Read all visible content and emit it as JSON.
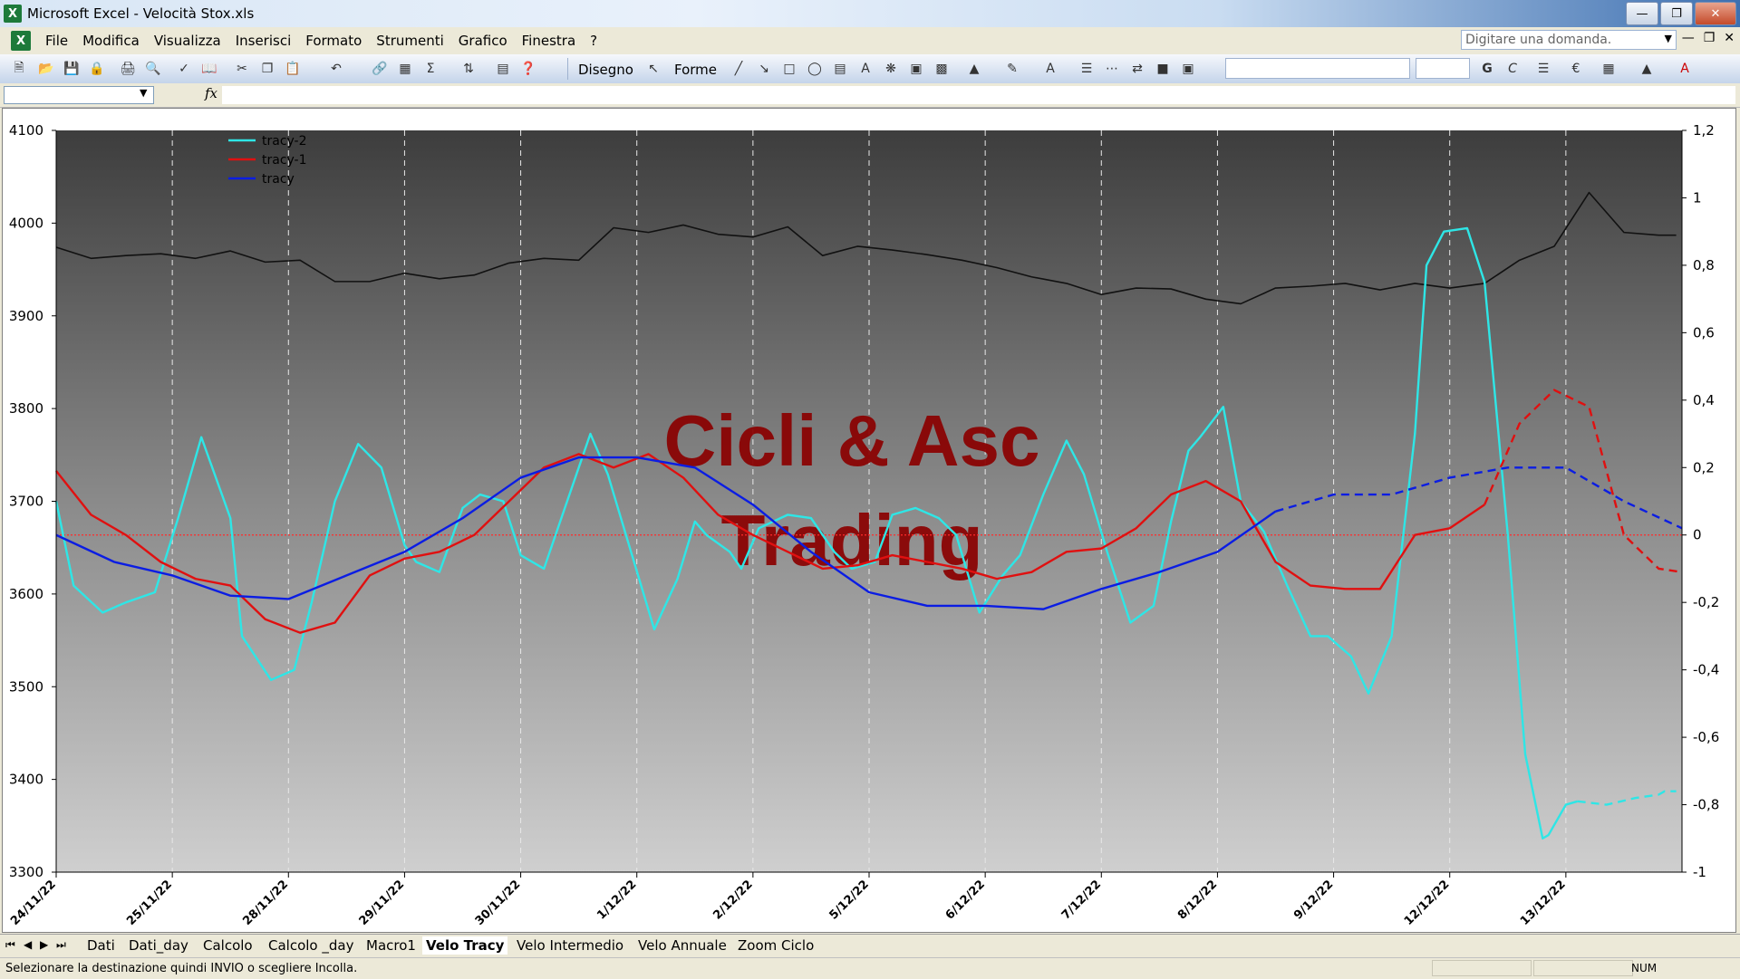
{
  "window": {
    "title": "Microsoft Excel - Velocità Stox.xls"
  },
  "menu": {
    "items": [
      "File",
      "Modifica",
      "Visualizza",
      "Inserisci",
      "Formato",
      "Strumenti",
      "Grafico",
      "Finestra",
      "?"
    ]
  },
  "ask_box": {
    "placeholder": "Digitare una domanda."
  },
  "toolbar": {
    "disegno_label": "Disegno",
    "forme_label": "Forme"
  },
  "chart_data": {
    "type": "line",
    "watermark": [
      "Cicli & Asc",
      "Trading"
    ],
    "categories": [
      "24/11/22",
      "25/11/22",
      "28/11/22",
      "29/11/22",
      "30/11/22",
      "1/12/22",
      "2/12/22",
      "5/12/22",
      "6/12/22",
      "7/12/22",
      "8/12/22",
      "9/12/22",
      "12/12/22",
      "13/12/22"
    ],
    "y_left": {
      "min": 3300,
      "max": 4100,
      "ticks": [
        "3300",
        "3400",
        "3500",
        "3600",
        "3700",
        "3800",
        "3900",
        "4000",
        "4100"
      ]
    },
    "y_right": {
      "min": -1,
      "max": 1.2,
      "ticks": [
        "-1",
        "-0,8",
        "-0,6",
        "-0,4",
        "-0,2",
        "0",
        "0,2",
        "0,4",
        "0,6",
        "0,8",
        "1",
        "1,2"
      ]
    },
    "legend": {
      "placement": "top-left",
      "entries": [
        "tracy-2",
        "tracy-1",
        "tracy"
      ]
    },
    "series": [
      {
        "name": "tracy-2",
        "color": "#2ee6e6",
        "axis": "right",
        "x": [
          0,
          0.15,
          0.4,
          0.6,
          0.85,
          1.05,
          1.25,
          1.5,
          1.6,
          1.85,
          2.05,
          2.2,
          2.4,
          2.6,
          2.8,
          3.0,
          3.1,
          3.3,
          3.5,
          3.65,
          3.85,
          4.0,
          4.2,
          4.35,
          4.6,
          4.75,
          4.95,
          5.15,
          5.35,
          5.5,
          5.6,
          5.8,
          5.9,
          6.05,
          6.3,
          6.5,
          6.7,
          6.85,
          7.05,
          7.2,
          7.4,
          7.6,
          7.75,
          7.95,
          8.15,
          8.3,
          8.5,
          8.7,
          8.85,
          9.05,
          9.25,
          9.45,
          9.6,
          9.75,
          9.85,
          10.05,
          10.2,
          10.4,
          10.6,
          10.8,
          10.95,
          11.15,
          11.3,
          11.5,
          11.7,
          11.8,
          11.95,
          12.15,
          12.3,
          12.5,
          12.65,
          12.8,
          12.85,
          13.0,
          13.1,
          13.35,
          13.6,
          13.8,
          13.85,
          13.95
        ],
        "y": [
          0.1,
          -0.15,
          -0.23,
          -0.2,
          -0.17,
          0.05,
          0.29,
          0.05,
          -0.3,
          -0.43,
          -0.4,
          -0.2,
          0.1,
          0.27,
          0.2,
          -0.03,
          -0.08,
          -0.11,
          0.08,
          0.12,
          0.1,
          -0.06,
          -0.1,
          0.05,
          0.3,
          0.18,
          -0.05,
          -0.28,
          -0.13,
          0.04,
          0.0,
          -0.05,
          -0.1,
          0.02,
          0.06,
          0.05,
          -0.05,
          -0.1,
          -0.08,
          0.06,
          0.08,
          0.05,
          0.0,
          -0.23,
          -0.12,
          -0.06,
          0.12,
          0.28,
          0.18,
          -0.05,
          -0.26,
          -0.21,
          0.04,
          0.25,
          0.29,
          0.38,
          0.1,
          0.01,
          -0.15,
          -0.3,
          -0.3,
          -0.36,
          -0.47,
          -0.3,
          0.3,
          0.8,
          0.9,
          0.91,
          0.75,
          0.0,
          -0.65,
          -0.9,
          -0.89,
          -0.8,
          -0.79,
          -0.8,
          -0.78,
          -0.77,
          -0.76,
          -0.76
        ],
        "dashed_from_x": 13.25
      },
      {
        "name": "tracy-1",
        "color": "#e01010",
        "axis": "right",
        "x": [
          0,
          0.3,
          0.6,
          0.9,
          1.2,
          1.5,
          1.8,
          2.1,
          2.4,
          2.7,
          3.0,
          3.3,
          3.6,
          3.9,
          4.2,
          4.5,
          4.8,
          5.1,
          5.4,
          5.7,
          6.0,
          6.3,
          6.6,
          6.9,
          7.2,
          7.5,
          7.8,
          8.1,
          8.4,
          8.7,
          9.0,
          9.3,
          9.6,
          9.9,
          10.2,
          10.5,
          10.8,
          11.1,
          11.4,
          11.7,
          12.0,
          12.3,
          12.6,
          12.9,
          13.2,
          13.5,
          13.8,
          14.0
        ],
        "y": [
          0.19,
          0.06,
          0.0,
          -0.08,
          -0.13,
          -0.15,
          -0.25,
          -0.29,
          -0.26,
          -0.12,
          -0.07,
          -0.05,
          0.0,
          0.1,
          0.2,
          0.24,
          0.2,
          0.24,
          0.17,
          0.06,
          0.0,
          -0.05,
          -0.1,
          -0.09,
          -0.06,
          -0.08,
          -0.1,
          -0.13,
          -0.11,
          -0.05,
          -0.04,
          0.02,
          0.12,
          0.16,
          0.1,
          -0.08,
          -0.15,
          -0.16,
          -0.16,
          0.0,
          0.02,
          0.09,
          0.33,
          0.43,
          0.38,
          0.0,
          -0.1,
          -0.11
        ],
        "dashed_from_x": 12.35
      },
      {
        "name": "tracy",
        "color": "#0b1de3",
        "axis": "right",
        "x": [
          0,
          0.5,
          1.0,
          1.5,
          2.0,
          2.5,
          3.0,
          3.5,
          4.0,
          4.5,
          5.0,
          5.5,
          6.0,
          6.5,
          7.0,
          7.5,
          8.0,
          8.5,
          9.0,
          9.5,
          10.0,
          10.5,
          11.0,
          11.5,
          12.0,
          12.5,
          13.0,
          13.5,
          14.0
        ],
        "y": [
          0.0,
          -0.08,
          -0.12,
          -0.18,
          -0.19,
          -0.12,
          -0.05,
          0.05,
          0.17,
          0.23,
          0.23,
          0.2,
          0.09,
          -0.05,
          -0.17,
          -0.21,
          -0.21,
          -0.22,
          -0.16,
          -0.11,
          -0.05,
          0.07,
          0.12,
          0.12,
          0.17,
          0.2,
          0.2,
          0.1,
          0.02
        ],
        "dashed_from_x": 10.9
      },
      {
        "name": "",
        "color": "#111111",
        "axis": "left",
        "x": [
          0,
          0.3,
          0.6,
          0.9,
          1.2,
          1.5,
          1.8,
          2.1,
          2.4,
          2.7,
          3.0,
          3.3,
          3.6,
          3.9,
          4.2,
          4.5,
          4.8,
          5.1,
          5.4,
          5.7,
          6.0,
          6.3,
          6.6,
          6.9,
          7.2,
          7.5,
          7.8,
          8.1,
          8.4,
          8.7,
          9.0,
          9.3,
          9.6,
          9.9,
          10.2,
          10.5,
          10.8,
          11.1,
          11.4,
          11.7,
          12.0,
          12.3,
          12.6,
          12.9,
          13.2,
          13.5,
          13.8,
          13.95
        ],
        "y": [
          3974,
          3962,
          3965,
          3967,
          3962,
          3970,
          3958,
          3960,
          3937,
          3937,
          3946,
          3940,
          3944,
          3957,
          3962,
          3960,
          3995,
          3990,
          3998,
          3988,
          3985,
          3996,
          3965,
          3975,
          3971,
          3966,
          3960,
          3952,
          3942,
          3935,
          3923,
          3930,
          3929,
          3918,
          3913,
          3930,
          3932,
          3935,
          3928,
          3935,
          3930,
          3935,
          3960,
          3975,
          4033,
          3990,
          3987,
          3987
        ]
      }
    ]
  },
  "sheet_tabs": [
    "Dati",
    "Dati_day",
    "Calcolo",
    "Calcolo _day",
    "Macro1",
    "Velo Tracy",
    "Velo Intermedio",
    "Velo Annuale",
    "Zoom Ciclo"
  ],
  "active_tab": "Velo Tracy",
  "status": {
    "message": "Selezionare la destinazione quindi INVIO o scegliere Incolla.",
    "num": "NUM"
  }
}
